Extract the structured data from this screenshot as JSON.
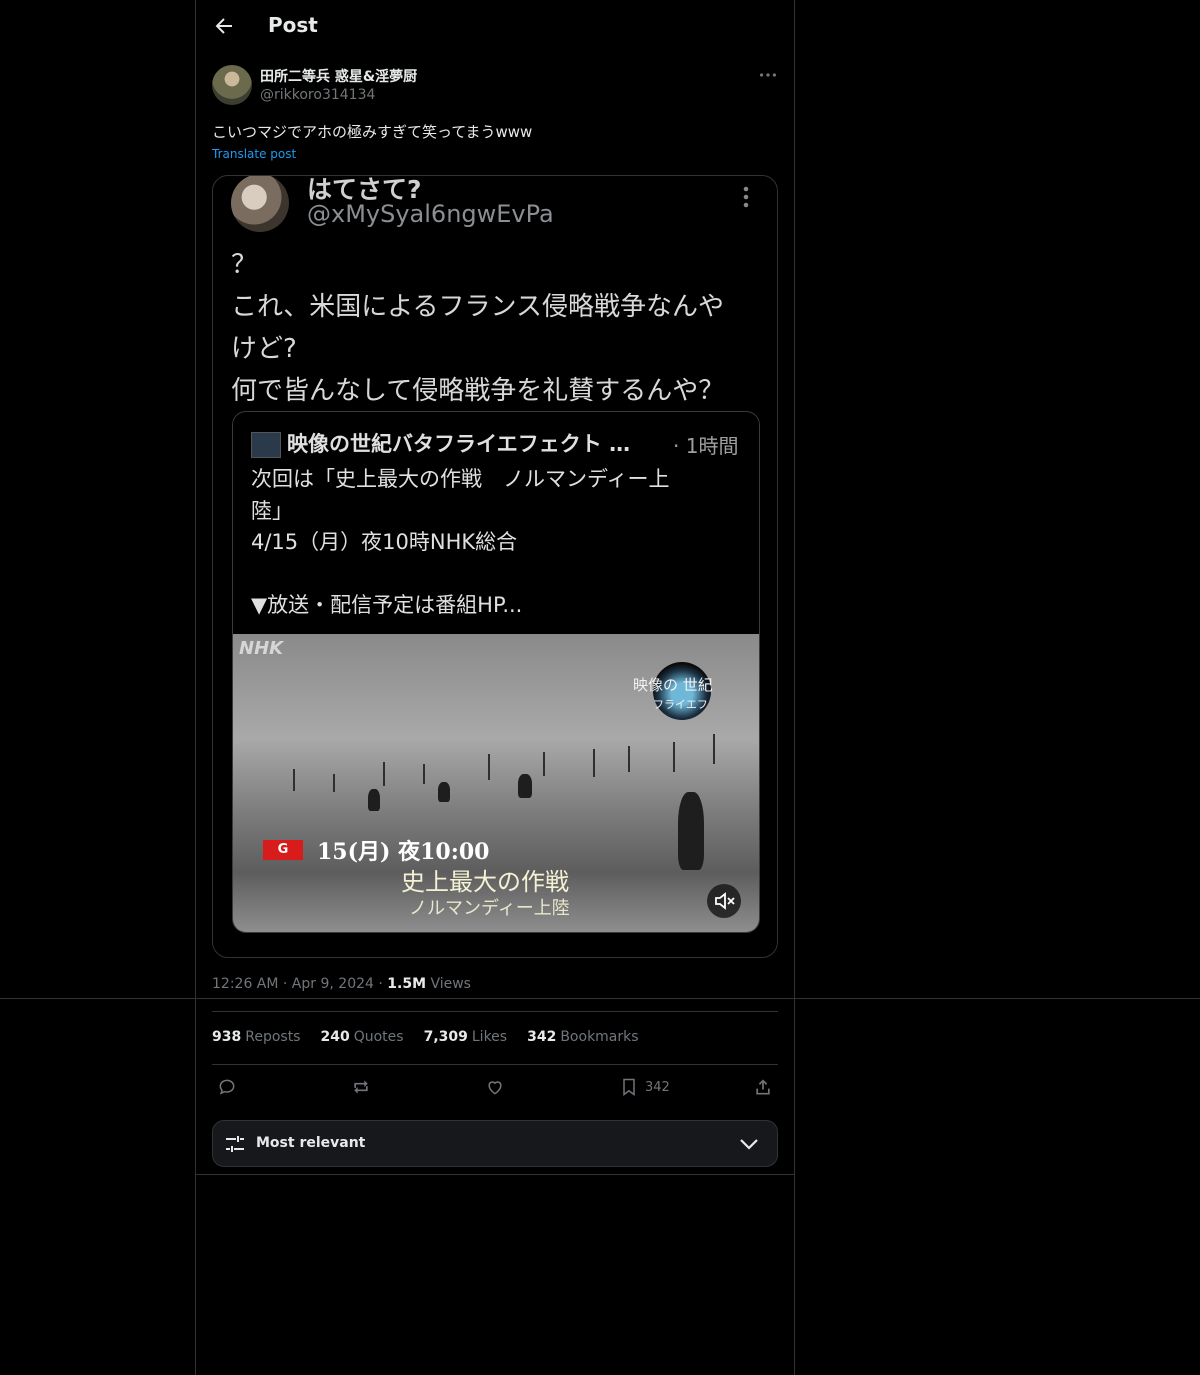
{
  "header": {
    "title": "Post"
  },
  "post": {
    "display_name": "田所二等兵 惑星&淫夢厨",
    "handle": "@rikkoro314134",
    "text": "こいつマジでアホの極みすぎて笑ってまうwww",
    "translate_label": "Translate post",
    "timestamp": "12:26 AM · Apr 9, 2024 · ",
    "views_count": "1.5M",
    "views_label": " Views"
  },
  "quoted": {
    "display_name": "はてさて?",
    "handle": "@xMySyal6ngwEvPa",
    "text": "？\nこれ、米国によるフランス侵略戦争なんや\nけど?\n何で皆んなして侵略戦争を礼賛するんや？",
    "inner": {
      "display_name": "映像の世紀バタフライエフェクト …",
      "time": "· 1時間",
      "text": "次回は「史上最大の作戦　ノルマンディー上\n陸」\n4/15（月）夜10時NHK総合\n\n▼放送・配信予定は番組HP...",
      "video": {
        "watermark": "NHK",
        "logo_text": "映像の 世紀",
        "logo_sub": "フライエフ",
        "badge": "G",
        "date": "15(月) 夜10:00",
        "title": "史上最大の作戦",
        "subtitle": "ノルマンディー上陸"
      }
    }
  },
  "stats": {
    "reposts_count": "938",
    "reposts_label": "Reposts",
    "quotes_count": "240",
    "quotes_label": "Quotes",
    "likes_count": "7,309",
    "likes_label": "Likes",
    "bookmarks_count": "342",
    "bookmarks_label": "Bookmarks"
  },
  "actions": {
    "bookmark_count": "342"
  },
  "sort": {
    "label": "Most relevant"
  },
  "colors": {
    "background": "#000000",
    "border": "#2f3336",
    "link": "#1d9bf0",
    "muted": "#71767b"
  }
}
